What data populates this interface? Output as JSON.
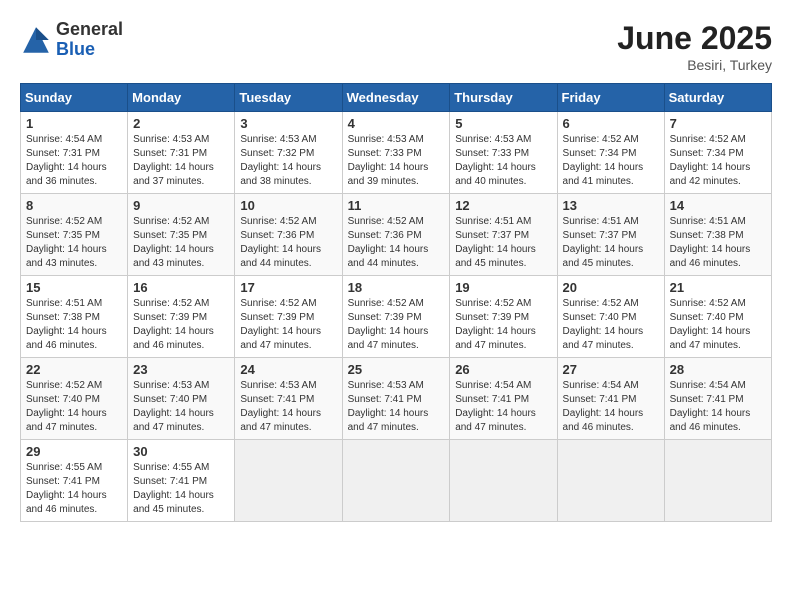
{
  "logo": {
    "general": "General",
    "blue": "Blue"
  },
  "title": "June 2025",
  "location": "Besiri, Turkey",
  "days_of_week": [
    "Sunday",
    "Monday",
    "Tuesday",
    "Wednesday",
    "Thursday",
    "Friday",
    "Saturday"
  ],
  "weeks": [
    [
      {
        "day": 1,
        "sunrise": "4:54 AM",
        "sunset": "7:31 PM",
        "daylight": "14 hours and 36 minutes."
      },
      {
        "day": 2,
        "sunrise": "4:53 AM",
        "sunset": "7:31 PM",
        "daylight": "14 hours and 37 minutes."
      },
      {
        "day": 3,
        "sunrise": "4:53 AM",
        "sunset": "7:32 PM",
        "daylight": "14 hours and 38 minutes."
      },
      {
        "day": 4,
        "sunrise": "4:53 AM",
        "sunset": "7:33 PM",
        "daylight": "14 hours and 39 minutes."
      },
      {
        "day": 5,
        "sunrise": "4:53 AM",
        "sunset": "7:33 PM",
        "daylight": "14 hours and 40 minutes."
      },
      {
        "day": 6,
        "sunrise": "4:52 AM",
        "sunset": "7:34 PM",
        "daylight": "14 hours and 41 minutes."
      },
      {
        "day": 7,
        "sunrise": "4:52 AM",
        "sunset": "7:34 PM",
        "daylight": "14 hours and 42 minutes."
      }
    ],
    [
      {
        "day": 8,
        "sunrise": "4:52 AM",
        "sunset": "7:35 PM",
        "daylight": "14 hours and 43 minutes."
      },
      {
        "day": 9,
        "sunrise": "4:52 AM",
        "sunset": "7:35 PM",
        "daylight": "14 hours and 43 minutes."
      },
      {
        "day": 10,
        "sunrise": "4:52 AM",
        "sunset": "7:36 PM",
        "daylight": "14 hours and 44 minutes."
      },
      {
        "day": 11,
        "sunrise": "4:52 AM",
        "sunset": "7:36 PM",
        "daylight": "14 hours and 44 minutes."
      },
      {
        "day": 12,
        "sunrise": "4:51 AM",
        "sunset": "7:37 PM",
        "daylight": "14 hours and 45 minutes."
      },
      {
        "day": 13,
        "sunrise": "4:51 AM",
        "sunset": "7:37 PM",
        "daylight": "14 hours and 45 minutes."
      },
      {
        "day": 14,
        "sunrise": "4:51 AM",
        "sunset": "7:38 PM",
        "daylight": "14 hours and 46 minutes."
      }
    ],
    [
      {
        "day": 15,
        "sunrise": "4:51 AM",
        "sunset": "7:38 PM",
        "daylight": "14 hours and 46 minutes."
      },
      {
        "day": 16,
        "sunrise": "4:52 AM",
        "sunset": "7:39 PM",
        "daylight": "14 hours and 46 minutes."
      },
      {
        "day": 17,
        "sunrise": "4:52 AM",
        "sunset": "7:39 PM",
        "daylight": "14 hours and 47 minutes."
      },
      {
        "day": 18,
        "sunrise": "4:52 AM",
        "sunset": "7:39 PM",
        "daylight": "14 hours and 47 minutes."
      },
      {
        "day": 19,
        "sunrise": "4:52 AM",
        "sunset": "7:39 PM",
        "daylight": "14 hours and 47 minutes."
      },
      {
        "day": 20,
        "sunrise": "4:52 AM",
        "sunset": "7:40 PM",
        "daylight": "14 hours and 47 minutes."
      },
      {
        "day": 21,
        "sunrise": "4:52 AM",
        "sunset": "7:40 PM",
        "daylight": "14 hours and 47 minutes."
      }
    ],
    [
      {
        "day": 22,
        "sunrise": "4:52 AM",
        "sunset": "7:40 PM",
        "daylight": "14 hours and 47 minutes."
      },
      {
        "day": 23,
        "sunrise": "4:53 AM",
        "sunset": "7:40 PM",
        "daylight": "14 hours and 47 minutes."
      },
      {
        "day": 24,
        "sunrise": "4:53 AM",
        "sunset": "7:41 PM",
        "daylight": "14 hours and 47 minutes."
      },
      {
        "day": 25,
        "sunrise": "4:53 AM",
        "sunset": "7:41 PM",
        "daylight": "14 hours and 47 minutes."
      },
      {
        "day": 26,
        "sunrise": "4:54 AM",
        "sunset": "7:41 PM",
        "daylight": "14 hours and 47 minutes."
      },
      {
        "day": 27,
        "sunrise": "4:54 AM",
        "sunset": "7:41 PM",
        "daylight": "14 hours and 46 minutes."
      },
      {
        "day": 28,
        "sunrise": "4:54 AM",
        "sunset": "7:41 PM",
        "daylight": "14 hours and 46 minutes."
      }
    ],
    [
      {
        "day": 29,
        "sunrise": "4:55 AM",
        "sunset": "7:41 PM",
        "daylight": "14 hours and 46 minutes."
      },
      {
        "day": 30,
        "sunrise": "4:55 AM",
        "sunset": "7:41 PM",
        "daylight": "14 hours and 45 minutes."
      },
      null,
      null,
      null,
      null,
      null
    ]
  ]
}
